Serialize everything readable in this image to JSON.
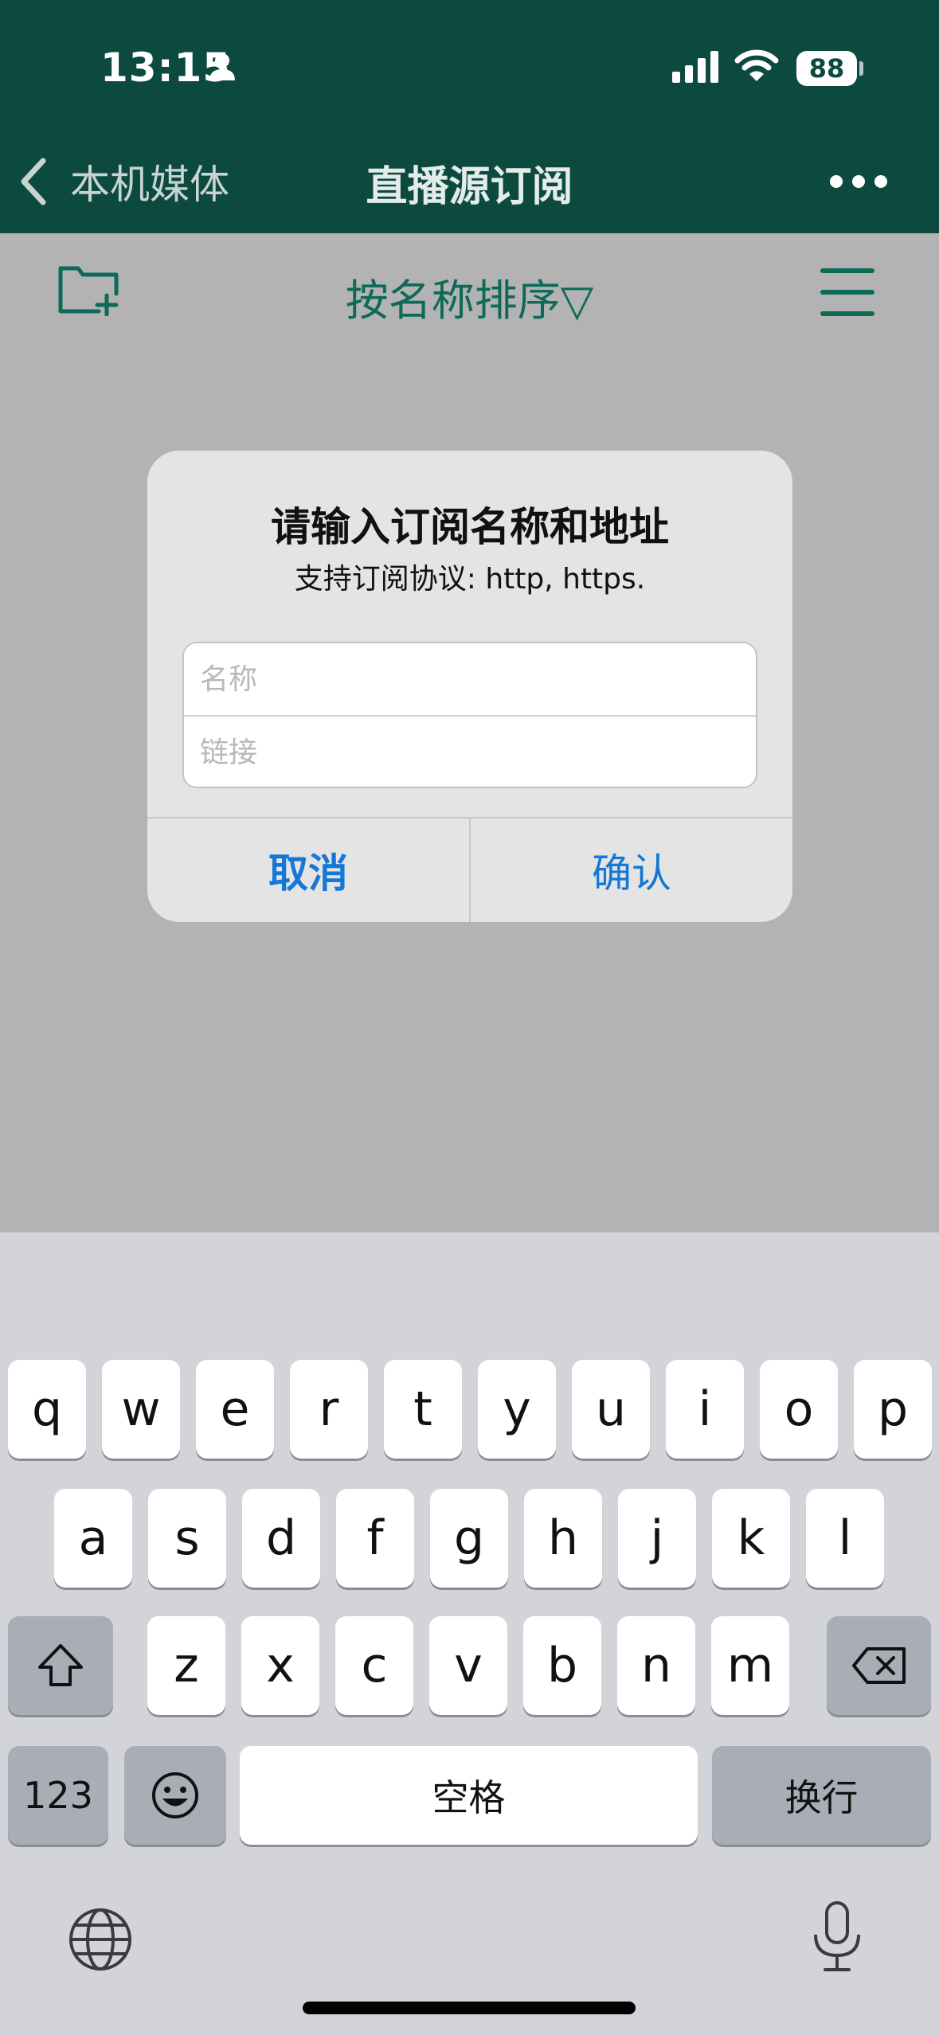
{
  "status_bar": {
    "time": "13:15",
    "battery": "88"
  },
  "nav": {
    "back_label": "本机媒体",
    "title": "直播源订阅"
  },
  "toolbar": {
    "sort_label": "按名称排序▽"
  },
  "dialog": {
    "title": "请输入订阅名称和地址",
    "message": "支持订阅协议: http, https.",
    "name_placeholder": "名称",
    "link_placeholder": "链接",
    "cancel_label": "取消",
    "confirm_label": "确认"
  },
  "keyboard": {
    "row1": [
      "q",
      "w",
      "e",
      "r",
      "t",
      "y",
      "u",
      "i",
      "o",
      "p"
    ],
    "row2": [
      "a",
      "s",
      "d",
      "f",
      "g",
      "h",
      "j",
      "k",
      "l"
    ],
    "row3": [
      "z",
      "x",
      "c",
      "v",
      "b",
      "n",
      "m"
    ],
    "numbers_label": "123",
    "space_label": "空格",
    "return_label": "换行"
  },
  "colors": {
    "header": "#0c4a40",
    "accent": "#0e6a58",
    "dialog_button": "#1577d6"
  }
}
